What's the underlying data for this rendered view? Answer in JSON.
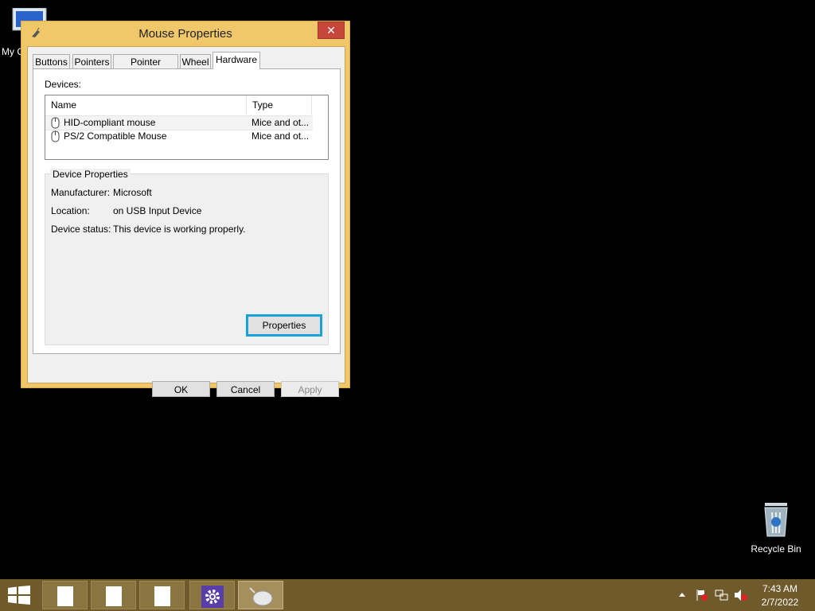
{
  "desktop": {
    "my_computer_label": "My C",
    "recycle_bin_label": "Recycle Bin"
  },
  "dialog": {
    "title": "Mouse Properties",
    "close_glyph": "✕",
    "tabs": [
      "Buttons",
      "Pointers",
      "Pointer Options",
      "Wheel",
      "Hardware"
    ],
    "active_tab": "Hardware",
    "devices_label": "Devices:",
    "columns": {
      "name": "Name",
      "type": "Type"
    },
    "devices": [
      {
        "name": "HID-compliant mouse",
        "type": "Mice and ot..."
      },
      {
        "name": "PS/2 Compatible Mouse",
        "type": "Mice and ot..."
      }
    ],
    "device_properties": {
      "title": "Device Properties",
      "manufacturer_label": "Manufacturer:",
      "manufacturer": "Microsoft",
      "location_label": "Location:",
      "location": "on USB Input Device",
      "status_label": "Device status:",
      "status": "This device is working properly.",
      "properties_button": "Properties"
    },
    "buttons": {
      "ok": "OK",
      "cancel": "Cancel",
      "apply": "Apply"
    }
  },
  "taskbar": {
    "icons": [
      "start-icon",
      "file-icon",
      "file-icon",
      "file-icon",
      "settings-icon",
      "mouse-icon"
    ],
    "clock_time": "7:43 AM",
    "clock_date": "2/7/2022",
    "tray_icons": [
      "show-hidden-icons",
      "action-center-flag-icon",
      "network-icon",
      "volume-muted-icon"
    ]
  },
  "colors": {
    "accent_focus": "#17a3d8",
    "window_frame": "#f0c86a",
    "close_button": "#c7463a",
    "taskbar": "#6f5a2c"
  }
}
